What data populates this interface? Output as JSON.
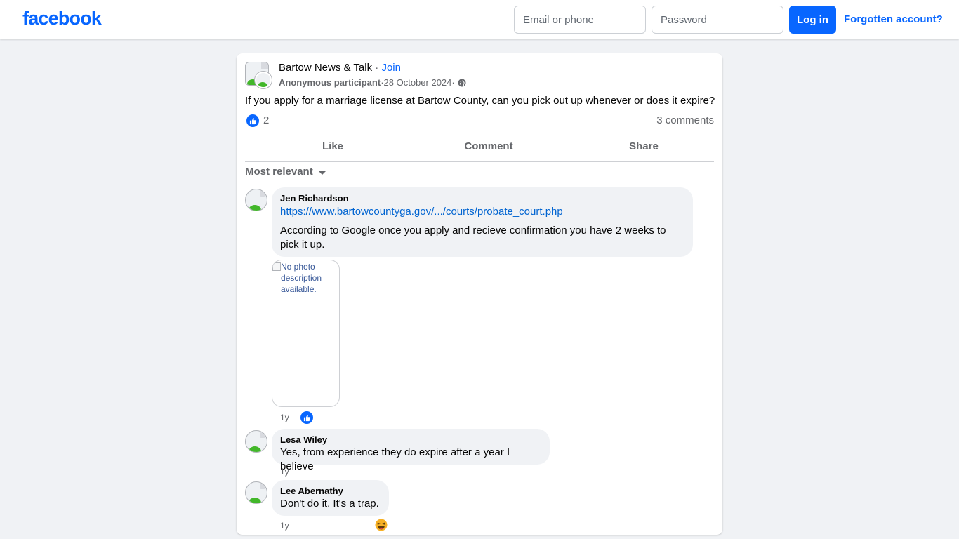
{
  "header": {
    "logo": "facebook",
    "email_placeholder": "Email or phone",
    "password_placeholder": "Password",
    "login_label": "Log in",
    "forgot_label": "Forgotten account?"
  },
  "post": {
    "group_name": "Bartow News & Talk",
    "separator": " · ",
    "join_label": "Join",
    "author": "Anonymous participant",
    "date": "28 October 2024",
    "text": "If you apply for a marriage license at Bartow County, can you pick out up whenever or does it expire?",
    "like_count": "2",
    "comment_count": "3 comments",
    "actions": {
      "like": "Like",
      "comment": "Comment",
      "share": "Share"
    }
  },
  "comments_sort": "Most relevant",
  "comments": [
    {
      "author": "Jen Richardson",
      "link": "https://www.bartowcountyga.gov/.../courts/probate_court.php",
      "text": "According to Google once you apply and recieve confirmation you have 2 weeks to pick it up.",
      "image_alt": "No photo description available.",
      "time": "1y",
      "reaction": "like-icon"
    },
    {
      "author": "Lesa Wiley",
      "text": "Yes, from experience they do expire after a year I believe",
      "time": "1y"
    },
    {
      "author": "Lee Abernathy",
      "text": "Don't do it. It's a trap.",
      "time": "1y",
      "reaction": "haha-icon"
    }
  ],
  "colors": {
    "brand": "#0866ff",
    "link": "#0064d1",
    "background": "#f0f2f5",
    "muted_text": "#65676b"
  }
}
